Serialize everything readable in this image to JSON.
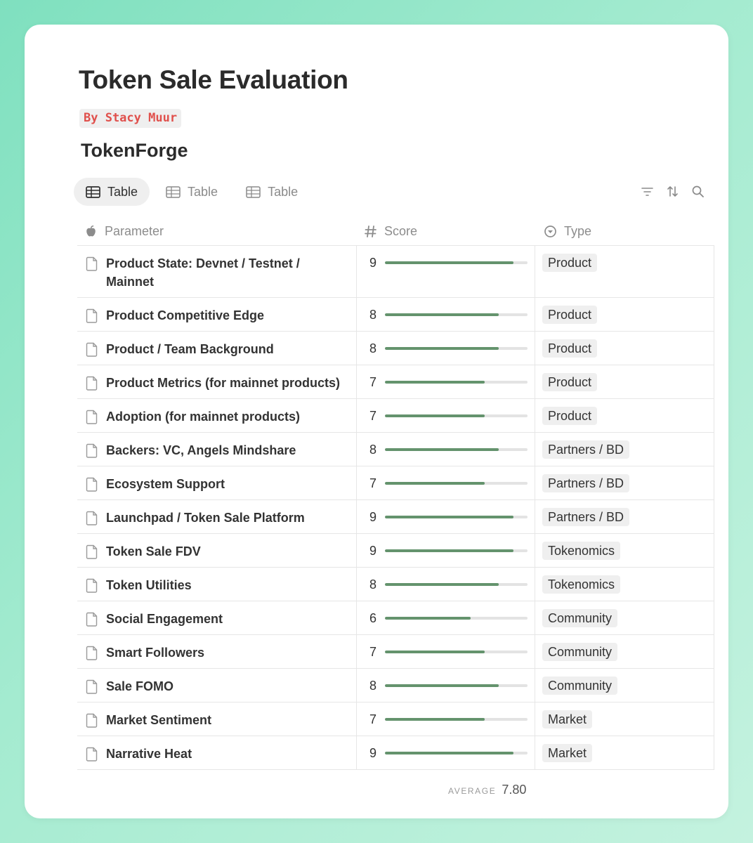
{
  "page": {
    "title": "Token Sale Evaluation",
    "author": "By Stacy Muur",
    "project": "TokenForge"
  },
  "views": [
    {
      "label": "Table",
      "active": true
    },
    {
      "label": "Table",
      "active": false
    },
    {
      "label": "Table",
      "active": false
    }
  ],
  "toolbar": {
    "icons": [
      "filter-icon",
      "sort-icon",
      "search-icon"
    ]
  },
  "columns": {
    "parameter": "Parameter",
    "score": "Score",
    "type": "Type"
  },
  "colors": {
    "bar_fill": "#64936d",
    "bar_track": "#e3e3e3",
    "author_text": "#e0504c",
    "tag_bg": "#efefef"
  },
  "score_max": 10,
  "rows": [
    {
      "parameter": "Product State: Devnet / Testnet / Mainnet",
      "score": 9,
      "type": "Product"
    },
    {
      "parameter": "Product Competitive Edge",
      "score": 8,
      "type": "Product"
    },
    {
      "parameter": "Product / Team Background",
      "score": 8,
      "type": "Product"
    },
    {
      "parameter": "Product Metrics (for mainnet products)",
      "score": 7,
      "type": "Product"
    },
    {
      "parameter": "Adoption (for mainnet products)",
      "score": 7,
      "type": "Product"
    },
    {
      "parameter": "Backers: VC, Angels Mindshare",
      "score": 8,
      "type": "Partners / BD"
    },
    {
      "parameter": "Ecosystem Support",
      "score": 7,
      "type": "Partners / BD"
    },
    {
      "parameter": "Launchpad / Token Sale Platform",
      "score": 9,
      "type": "Partners / BD"
    },
    {
      "parameter": "Token Sale FDV",
      "score": 9,
      "type": "Tokenomics"
    },
    {
      "parameter": "Token Utilities",
      "score": 8,
      "type": "Tokenomics"
    },
    {
      "parameter": "Social Engagement",
      "score": 6,
      "type": "Community"
    },
    {
      "parameter": "Smart Followers",
      "score": 7,
      "type": "Community"
    },
    {
      "parameter": "Sale FOMO",
      "score": 8,
      "type": "Community"
    },
    {
      "parameter": "Market Sentiment",
      "score": 7,
      "type": "Market"
    },
    {
      "parameter": "Narrative Heat",
      "score": 9,
      "type": "Market"
    }
  ],
  "summary": {
    "label": "AVERAGE",
    "value": "7.80"
  }
}
